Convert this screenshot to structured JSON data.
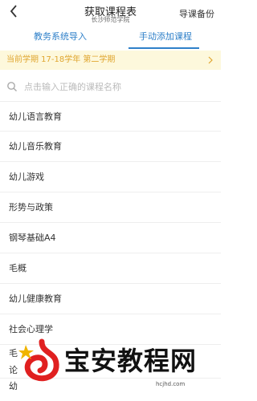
{
  "header": {
    "title": "获取课程表",
    "subtitle": "长沙师范学院",
    "backup_label": "导课备份"
  },
  "tabs": [
    {
      "label": "教务系统导入",
      "active": false
    },
    {
      "label": "手动添加课程",
      "active": true
    }
  ],
  "banner": {
    "text": "当前学期 17-18学年 第二学期"
  },
  "search": {
    "placeholder": "点击输入正确的课程名称",
    "value": ""
  },
  "courses": [
    {
      "name": "幼儿语言教育"
    },
    {
      "name": "幼儿音乐教育"
    },
    {
      "name": "幼儿游戏"
    },
    {
      "name": "形势与政策"
    },
    {
      "name": "钢琴基础A4"
    },
    {
      "name": "毛概"
    },
    {
      "name": "幼儿健康教育"
    },
    {
      "name": "社会心理学"
    },
    {
      "name": "毛"
    },
    {
      "name": "论"
    },
    {
      "name": "幼"
    }
  ],
  "watermark": {
    "text": "宝安教程网",
    "url": "hcjhd.com"
  },
  "colors": {
    "accent": "#2f80c9",
    "banner_bg": "#fdf8dc",
    "banner_text": "#e0a630",
    "watermark_red": "#e02020"
  }
}
